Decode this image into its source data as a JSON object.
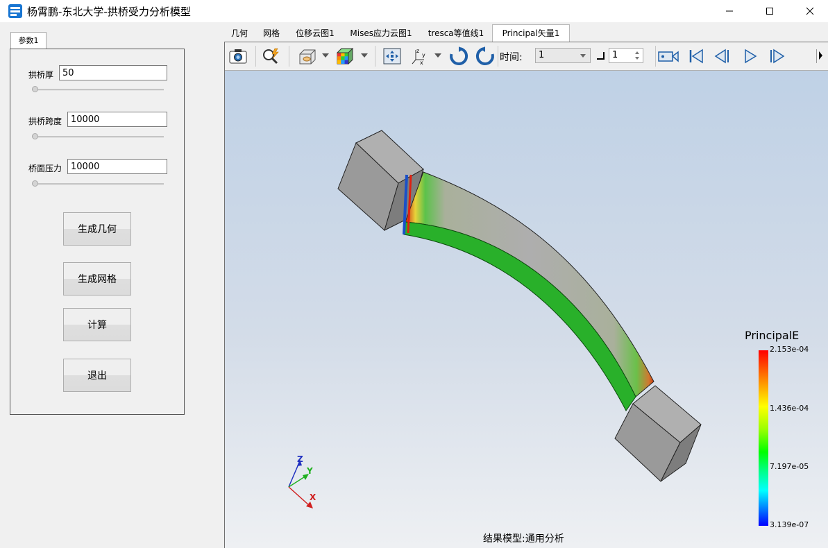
{
  "window": {
    "title": "杨霄鹏-东北大学-拱桥受力分析模型"
  },
  "params": {
    "tab": "参数1",
    "arch_thickness": {
      "label": "拱桥厚",
      "value": "50"
    },
    "arch_span": {
      "label": "拱桥跨度",
      "value": "10000"
    },
    "deck_pressure": {
      "label": "桥面压力",
      "value": "10000"
    },
    "buttons": {
      "gen_geometry": "生成几何",
      "gen_mesh": "生成网格",
      "compute": "计算",
      "exit": "退出"
    }
  },
  "tabs": [
    "几何",
    "网格",
    "位移云图1",
    "Mises应力云图1",
    "tresca等值线1",
    "Principal矢量1"
  ],
  "active_tab_index": 5,
  "toolbar": {
    "time_label": "时间:",
    "time_value": "1",
    "step_value": "1",
    "icons": [
      "camera-icon",
      "zoom-icon",
      "view-mode-icon",
      "color-cube-icon",
      "fit-view-icon",
      "axes-icon",
      "rotate-cw-icon",
      "rotate-ccw-icon",
      "record-icon",
      "first-frame-icon",
      "prev-frame-icon",
      "play-icon",
      "next-frame-icon"
    ]
  },
  "legend": {
    "title": "PrincipalE",
    "labels": [
      "2.153e-04",
      "1.436e-04",
      "7.197e-05",
      "3.139e-07"
    ]
  },
  "triad": {
    "x": "X",
    "y": "Y",
    "z": "Z"
  },
  "caption": "结果模型:通用分析",
  "colors": {
    "accent": "#0a64c8",
    "legend_top": "#ff0000",
    "legend_bottom": "#0000ff"
  }
}
